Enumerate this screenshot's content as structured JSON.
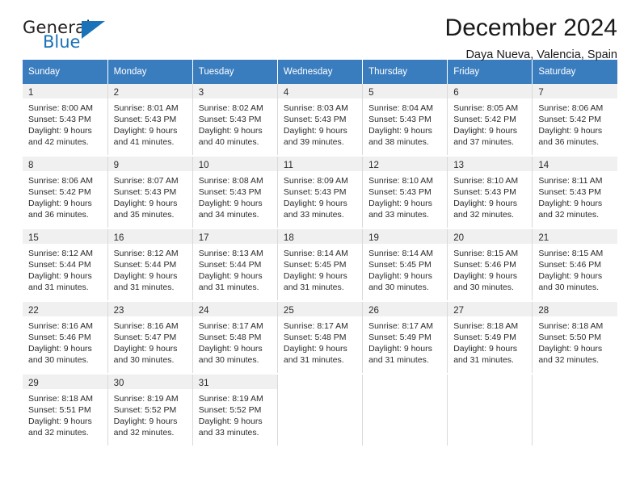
{
  "logo": {
    "word1": "General",
    "word2": "Blue",
    "triangle_color": "#1a72b8",
    "text_color": "#231f20"
  },
  "header": {
    "title": "December 2024",
    "subtitle": "Daya Nueva, Valencia, Spain",
    "header_bg": "#3a7dbf",
    "header_text": "#ffffff"
  },
  "weekday_headers": [
    "Sunday",
    "Monday",
    "Tuesday",
    "Wednesday",
    "Thursday",
    "Friday",
    "Saturday"
  ],
  "weeks": [
    [
      {
        "date": "1",
        "sunrise": "Sunrise: 8:00 AM",
        "sunset": "Sunset: 5:43 PM",
        "daylight1": "Daylight: 9 hours",
        "daylight2": "and 42 minutes."
      },
      {
        "date": "2",
        "sunrise": "Sunrise: 8:01 AM",
        "sunset": "Sunset: 5:43 PM",
        "daylight1": "Daylight: 9 hours",
        "daylight2": "and 41 minutes."
      },
      {
        "date": "3",
        "sunrise": "Sunrise: 8:02 AM",
        "sunset": "Sunset: 5:43 PM",
        "daylight1": "Daylight: 9 hours",
        "daylight2": "and 40 minutes."
      },
      {
        "date": "4",
        "sunrise": "Sunrise: 8:03 AM",
        "sunset": "Sunset: 5:43 PM",
        "daylight1": "Daylight: 9 hours",
        "daylight2": "and 39 minutes."
      },
      {
        "date": "5",
        "sunrise": "Sunrise: 8:04 AM",
        "sunset": "Sunset: 5:43 PM",
        "daylight1": "Daylight: 9 hours",
        "daylight2": "and 38 minutes."
      },
      {
        "date": "6",
        "sunrise": "Sunrise: 8:05 AM",
        "sunset": "Sunset: 5:42 PM",
        "daylight1": "Daylight: 9 hours",
        "daylight2": "and 37 minutes."
      },
      {
        "date": "7",
        "sunrise": "Sunrise: 8:06 AM",
        "sunset": "Sunset: 5:42 PM",
        "daylight1": "Daylight: 9 hours",
        "daylight2": "and 36 minutes."
      }
    ],
    [
      {
        "date": "8",
        "sunrise": "Sunrise: 8:06 AM",
        "sunset": "Sunset: 5:42 PM",
        "daylight1": "Daylight: 9 hours",
        "daylight2": "and 36 minutes."
      },
      {
        "date": "9",
        "sunrise": "Sunrise: 8:07 AM",
        "sunset": "Sunset: 5:43 PM",
        "daylight1": "Daylight: 9 hours",
        "daylight2": "and 35 minutes."
      },
      {
        "date": "10",
        "sunrise": "Sunrise: 8:08 AM",
        "sunset": "Sunset: 5:43 PM",
        "daylight1": "Daylight: 9 hours",
        "daylight2": "and 34 minutes."
      },
      {
        "date": "11",
        "sunrise": "Sunrise: 8:09 AM",
        "sunset": "Sunset: 5:43 PM",
        "daylight1": "Daylight: 9 hours",
        "daylight2": "and 33 minutes."
      },
      {
        "date": "12",
        "sunrise": "Sunrise: 8:10 AM",
        "sunset": "Sunset: 5:43 PM",
        "daylight1": "Daylight: 9 hours",
        "daylight2": "and 33 minutes."
      },
      {
        "date": "13",
        "sunrise": "Sunrise: 8:10 AM",
        "sunset": "Sunset: 5:43 PM",
        "daylight1": "Daylight: 9 hours",
        "daylight2": "and 32 minutes."
      },
      {
        "date": "14",
        "sunrise": "Sunrise: 8:11 AM",
        "sunset": "Sunset: 5:43 PM",
        "daylight1": "Daylight: 9 hours",
        "daylight2": "and 32 minutes."
      }
    ],
    [
      {
        "date": "15",
        "sunrise": "Sunrise: 8:12 AM",
        "sunset": "Sunset: 5:44 PM",
        "daylight1": "Daylight: 9 hours",
        "daylight2": "and 31 minutes."
      },
      {
        "date": "16",
        "sunrise": "Sunrise: 8:12 AM",
        "sunset": "Sunset: 5:44 PM",
        "daylight1": "Daylight: 9 hours",
        "daylight2": "and 31 minutes."
      },
      {
        "date": "17",
        "sunrise": "Sunrise: 8:13 AM",
        "sunset": "Sunset: 5:44 PM",
        "daylight1": "Daylight: 9 hours",
        "daylight2": "and 31 minutes."
      },
      {
        "date": "18",
        "sunrise": "Sunrise: 8:14 AM",
        "sunset": "Sunset: 5:45 PM",
        "daylight1": "Daylight: 9 hours",
        "daylight2": "and 31 minutes."
      },
      {
        "date": "19",
        "sunrise": "Sunrise: 8:14 AM",
        "sunset": "Sunset: 5:45 PM",
        "daylight1": "Daylight: 9 hours",
        "daylight2": "and 30 minutes."
      },
      {
        "date": "20",
        "sunrise": "Sunrise: 8:15 AM",
        "sunset": "Sunset: 5:46 PM",
        "daylight1": "Daylight: 9 hours",
        "daylight2": "and 30 minutes."
      },
      {
        "date": "21",
        "sunrise": "Sunrise: 8:15 AM",
        "sunset": "Sunset: 5:46 PM",
        "daylight1": "Daylight: 9 hours",
        "daylight2": "and 30 minutes."
      }
    ],
    [
      {
        "date": "22",
        "sunrise": "Sunrise: 8:16 AM",
        "sunset": "Sunset: 5:46 PM",
        "daylight1": "Daylight: 9 hours",
        "daylight2": "and 30 minutes."
      },
      {
        "date": "23",
        "sunrise": "Sunrise: 8:16 AM",
        "sunset": "Sunset: 5:47 PM",
        "daylight1": "Daylight: 9 hours",
        "daylight2": "and 30 minutes."
      },
      {
        "date": "24",
        "sunrise": "Sunrise: 8:17 AM",
        "sunset": "Sunset: 5:48 PM",
        "daylight1": "Daylight: 9 hours",
        "daylight2": "and 30 minutes."
      },
      {
        "date": "25",
        "sunrise": "Sunrise: 8:17 AM",
        "sunset": "Sunset: 5:48 PM",
        "daylight1": "Daylight: 9 hours",
        "daylight2": "and 31 minutes."
      },
      {
        "date": "26",
        "sunrise": "Sunrise: 8:17 AM",
        "sunset": "Sunset: 5:49 PM",
        "daylight1": "Daylight: 9 hours",
        "daylight2": "and 31 minutes."
      },
      {
        "date": "27",
        "sunrise": "Sunrise: 8:18 AM",
        "sunset": "Sunset: 5:49 PM",
        "daylight1": "Daylight: 9 hours",
        "daylight2": "and 31 minutes."
      },
      {
        "date": "28",
        "sunrise": "Sunrise: 8:18 AM",
        "sunset": "Sunset: 5:50 PM",
        "daylight1": "Daylight: 9 hours",
        "daylight2": "and 32 minutes."
      }
    ],
    [
      {
        "date": "29",
        "sunrise": "Sunrise: 8:18 AM",
        "sunset": "Sunset: 5:51 PM",
        "daylight1": "Daylight: 9 hours",
        "daylight2": "and 32 minutes."
      },
      {
        "date": "30",
        "sunrise": "Sunrise: 8:19 AM",
        "sunset": "Sunset: 5:52 PM",
        "daylight1": "Daylight: 9 hours",
        "daylight2": "and 32 minutes."
      },
      {
        "date": "31",
        "sunrise": "Sunrise: 8:19 AM",
        "sunset": "Sunset: 5:52 PM",
        "daylight1": "Daylight: 9 hours",
        "daylight2": "and 33 minutes."
      },
      {
        "date": "",
        "sunrise": "",
        "sunset": "",
        "daylight1": "",
        "daylight2": ""
      },
      {
        "date": "",
        "sunrise": "",
        "sunset": "",
        "daylight1": "",
        "daylight2": ""
      },
      {
        "date": "",
        "sunrise": "",
        "sunset": "",
        "daylight1": "",
        "daylight2": ""
      },
      {
        "date": "",
        "sunrise": "",
        "sunset": "",
        "daylight1": "",
        "daylight2": ""
      }
    ]
  ]
}
